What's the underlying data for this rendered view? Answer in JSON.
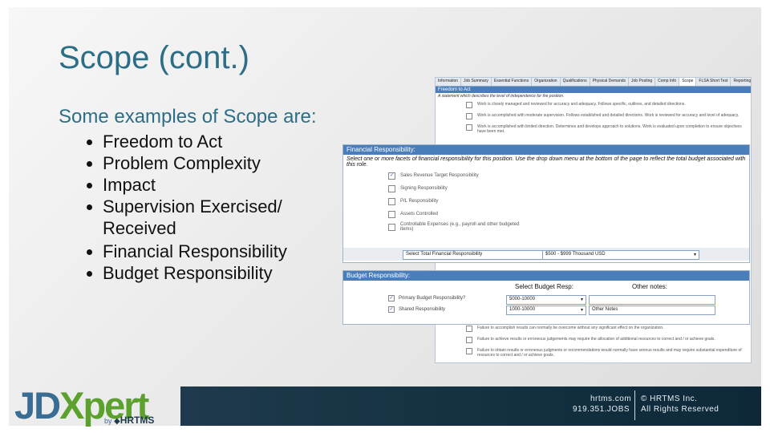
{
  "slide": {
    "title": "Scope (cont.)",
    "intro": "Some examples of Scope are:",
    "bullets": [
      "Freedom to Act",
      "Problem Complexity",
      "Impact",
      "Supervision Exercised/ Received"
    ],
    "bullets2": [
      "Financial Responsibility",
      "Budget Responsibility"
    ]
  },
  "app": {
    "tabs": [
      "Information",
      "Job Summary",
      "Essential Functions",
      "Organization",
      "Qualifications",
      "Physical Demands",
      "Job Posting",
      "Comp Info",
      "Scope",
      "FLSA Short Test",
      "Reporting"
    ],
    "freedom_header": "Freedom to Act",
    "freedom_sub": "A statement which describes the level of independence for the position.",
    "freedom_options": [
      "Work is closely managed and reviewed for accuracy and adequacy. Follows specific, outlines, and detailed directions.",
      "Work is accomplished with moderate supervision. Follows established and detailed directions. Work is reviewed for accuracy and level of adequacy.",
      "Work is accomplished with limited direction. Determines and develops approach to solutions. Work is evaluated upon completion to ensure objectives have been met."
    ],
    "financial": {
      "header": "Financial Responsibility:",
      "desc": "Select one or more facets of financial responsibility for this position. Use the drop down menu at the bottom of the page to reflect the total budget associated with this role.",
      "options": [
        {
          "label": "Sales Revenue Target Responsibility",
          "checked": true
        },
        {
          "label": "Signing Responsibility",
          "checked": false
        },
        {
          "label": "P/L Responsibility",
          "checked": false
        },
        {
          "label": "Assets Controlled",
          "checked": false
        },
        {
          "label": "Controllable Expenses (e.g., payroll and other budgeted items)",
          "checked": false
        }
      ],
      "select_label": "Select Total Financial Responsibility",
      "select_value": "$500 - $999 Thousand USD"
    },
    "budget": {
      "header": "Budget Responsibility:",
      "col1": "Select Budget Resp:",
      "col2": "Other notes:",
      "rows": [
        {
          "label": "Primary Budget Responsibility?",
          "checked": true,
          "value": "5000-10000",
          "note": ""
        },
        {
          "label": "Shared Responsibility",
          "checked": true,
          "value": "1000-10000",
          "note": "Other Notes"
        }
      ]
    },
    "bottom_options": [
      "Failure to accomplish results can normally be overcome without any significant effect on the organization.",
      "Failure to achieve results or erroneous judgements may require the allocation of additional resources to correct and / or achieve goals.",
      "Failure to obtain results or erroneous judgments or recommendations would normally have serious results and may require substantial expenditure of resources to correct and / or achieve goals."
    ]
  },
  "footer": {
    "site": "hrtms.com",
    "phone": "919.351.JOBS",
    "copyright": "© HRTMS Inc.",
    "rights": "All Rights Reserved",
    "logo_jd": "JD",
    "logo_xpert": "Xpert",
    "logo_by": "by",
    "logo_hrtms": "HRTMS"
  },
  "colors": {
    "title": "#2d6e86",
    "header_bar": "#4a7ebb",
    "footer": "#123040",
    "logo_green": "#5ca02d",
    "logo_blue": "#3a6d93"
  }
}
